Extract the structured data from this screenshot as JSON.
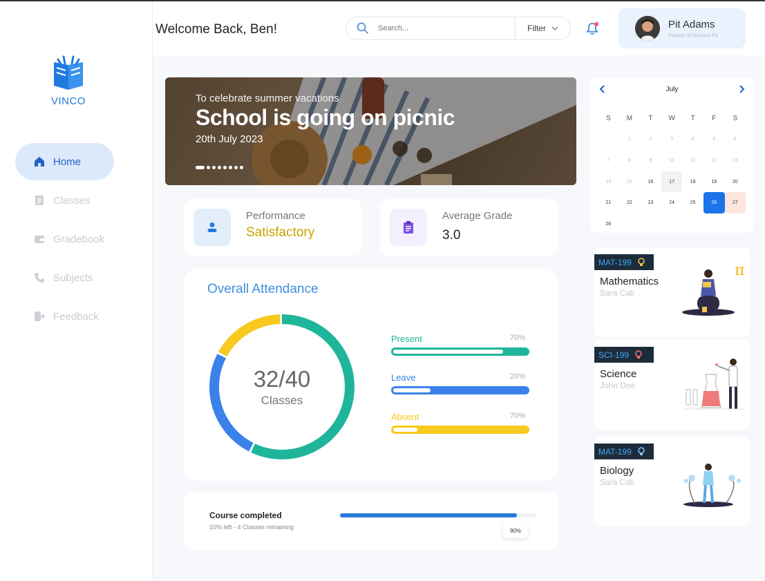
{
  "brand": {
    "name": "VINCO"
  },
  "sidebar": {
    "items": [
      {
        "label": "Home",
        "icon": "home-icon",
        "active": true
      },
      {
        "label": "Classes",
        "icon": "document-icon",
        "active": false
      },
      {
        "label": "Gradebook",
        "icon": "wallet-icon",
        "active": false
      },
      {
        "label": "Subjects",
        "icon": "phone-icon",
        "active": false
      },
      {
        "label": "Feedback",
        "icon": "logout-icon",
        "active": false
      }
    ]
  },
  "header": {
    "welcome": "Welcome Back, Ben!",
    "search_placeholder": "Search...",
    "filter_label": "Filter",
    "profile": {
      "name": "Pit Adams",
      "subtitle": "Parent of Nashra Pit"
    }
  },
  "banner": {
    "kicker": "To celebrate summer vacations",
    "title": "School is going on picnic",
    "date": "20th July 2023",
    "slide_count": 8,
    "active_slide": 1
  },
  "stats": {
    "performance": {
      "label": "Performance",
      "value": "Satisfactory"
    },
    "grade": {
      "label": "Average Grade",
      "value": "3.0"
    }
  },
  "attendance": {
    "title": "Overall Attendance",
    "center_value": "32/40",
    "center_label": "Classes",
    "rows": [
      {
        "label": "Present",
        "percent_text": "70%",
        "fill": 0.82,
        "color": "#1fb59b"
      },
      {
        "label": "Leave",
        "percent_text": "20%",
        "fill": 0.28,
        "color": "#3a82ea"
      },
      {
        "label": "Absent",
        "percent_text": "70%",
        "fill": 0.18,
        "color": "#f8c91f"
      }
    ],
    "donut": [
      {
        "name": "Present",
        "fraction": 0.575,
        "color": "#1fb59b"
      },
      {
        "name": "Leave",
        "fraction": 0.255,
        "color": "#3a82ea"
      },
      {
        "name": "Absent",
        "fraction": 0.17,
        "color": "#f8c91f"
      }
    ]
  },
  "course": {
    "title": "Course completed",
    "subtitle": "10% left  - 4 Classes remaining",
    "percent_text": "90%",
    "progress": 0.9
  },
  "calendar": {
    "month": "July",
    "weekdays": [
      "S",
      "M",
      "T",
      "W",
      "T",
      "F",
      "S"
    ],
    "rows": [
      [
        "",
        "1",
        "2",
        "3",
        "4",
        "5",
        "6"
      ],
      [
        "7",
        "8",
        "9",
        "10",
        "11",
        "12",
        "13"
      ],
      [
        "14",
        "15",
        "16",
        "17",
        "18",
        "19",
        "20"
      ],
      [
        "21",
        "22",
        "23",
        "24",
        "25",
        "26",
        "27"
      ],
      [
        "28",
        "",
        "",
        "",
        "",
        "",
        ""
      ]
    ],
    "today": "26",
    "dark_from": "16"
  },
  "subjects": [
    {
      "code": "MAT-199",
      "name": "Mathematics",
      "teacher": "Sara Cali",
      "code_color": "#3fa9f5",
      "bulb_color": "#f7c548"
    },
    {
      "code": "SCI-199",
      "name": "Science",
      "teacher": "John Doe",
      "code_color": "#3fa9f5",
      "bulb_color": "#ff6b6b"
    },
    {
      "code": "MAT-199",
      "name": "Biology",
      "teacher": "Sara Cali",
      "code_color": "#3fa9f5",
      "bulb_color": "#7cc7ff"
    }
  ]
}
